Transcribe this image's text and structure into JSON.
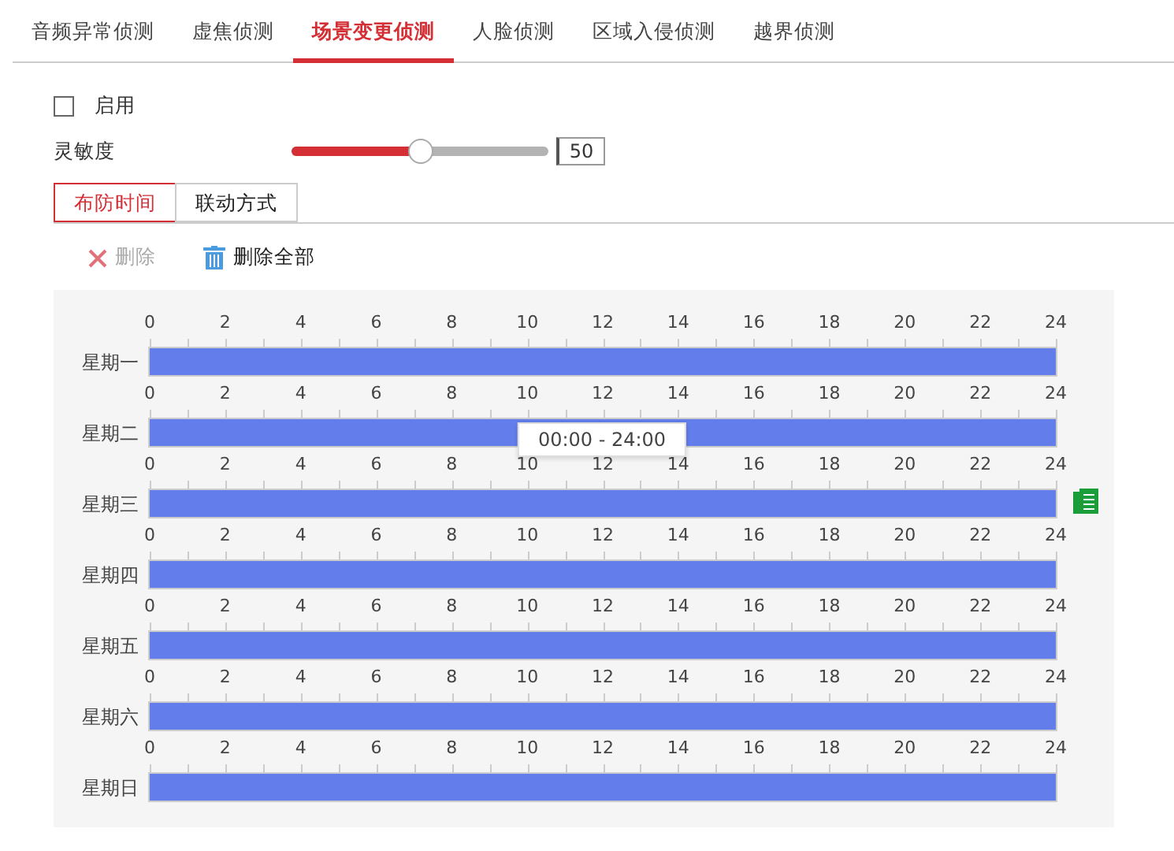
{
  "tabs": [
    {
      "label": "音频异常侦测",
      "selected": false
    },
    {
      "label": "虚焦侦测",
      "selected": false
    },
    {
      "label": "场景变更侦测",
      "selected": true
    },
    {
      "label": "人脸侦测",
      "selected": false
    },
    {
      "label": "区域入侵侦测",
      "selected": false
    },
    {
      "label": "越界侦测",
      "selected": false
    }
  ],
  "enable": {
    "label": "启用",
    "checked": false
  },
  "sensitivity": {
    "label": "灵敏度",
    "level": 0.5,
    "value": "50"
  },
  "sub_tabs": [
    {
      "label": "布防时间",
      "selected": true
    },
    {
      "label": "联动方式",
      "selected": false
    }
  ],
  "toolbar": [
    {
      "kind": "delete",
      "label": "删除",
      "disabled": true
    },
    {
      "kind": "delete_all",
      "label": "删除全部",
      "disabled": false
    }
  ],
  "schedule": {
    "days": [
      {
        "label": "星期一",
        "ticks": [
          "0",
          "2",
          "4",
          "6",
          "8",
          "10",
          "12",
          "14",
          "16",
          "18",
          "20",
          "22",
          "24"
        ],
        "level": 1
      },
      {
        "label": "星期二",
        "ticks": [
          "0",
          "2",
          "4",
          "6",
          "8",
          "10",
          "12",
          "14",
          "16",
          "18",
          "20",
          "22",
          "24"
        ],
        "level": 1
      },
      {
        "label": "星期三",
        "ticks": [
          "0",
          "2",
          "4",
          "6",
          "8",
          "10",
          "12",
          "14",
          "16",
          "18",
          "20",
          "22",
          "24"
        ],
        "level": 1,
        "tooltip": "00:00 - 24:00",
        "copy": true
      },
      {
        "label": "星期四",
        "ticks": [
          "0",
          "2",
          "4",
          "6",
          "8",
          "10",
          "12",
          "14",
          "16",
          "18",
          "20",
          "22",
          "24"
        ],
        "level": 1
      },
      {
        "label": "星期五",
        "ticks": [
          "0",
          "2",
          "4",
          "6",
          "8",
          "10",
          "12",
          "14",
          "16",
          "18",
          "20",
          "22",
          "24"
        ],
        "level": 1
      },
      {
        "label": "星期六",
        "ticks": [
          "0",
          "2",
          "4",
          "6",
          "8",
          "10",
          "12",
          "14",
          "16",
          "18",
          "20",
          "22",
          "24"
        ],
        "level": 1
      },
      {
        "label": "星期日",
        "ticks": [
          "0",
          "2",
          "4",
          "6",
          "8",
          "10",
          "12",
          "14",
          "16",
          "18",
          "20",
          "22",
          "24"
        ],
        "level": 1
      }
    ]
  }
}
